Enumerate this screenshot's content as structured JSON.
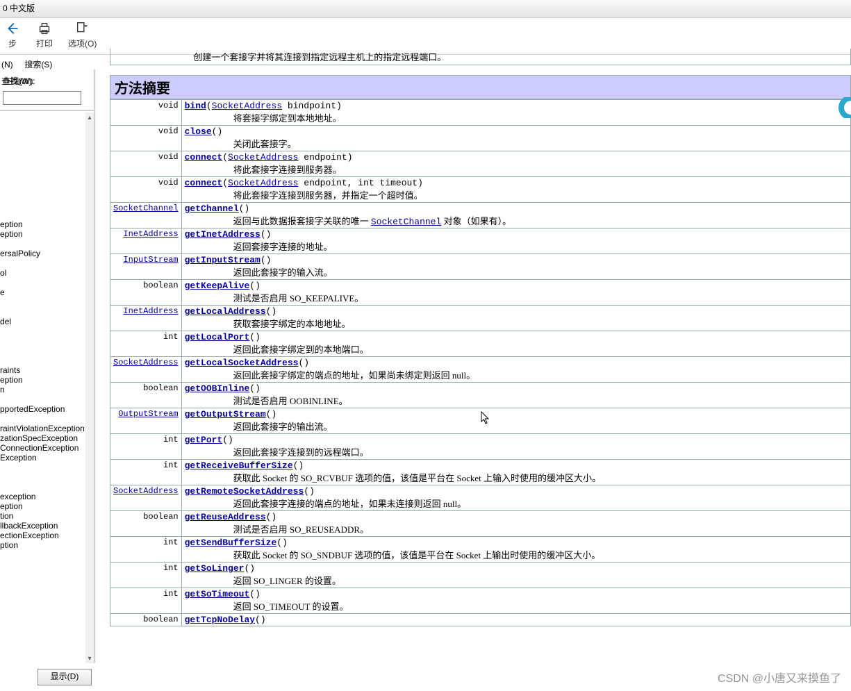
{
  "window": {
    "title": "0 中文版"
  },
  "toolbar": {
    "back": "步",
    "print": "打印",
    "options": "选项(O)"
  },
  "tabs": {
    "n": "(N)",
    "search": "搜索(S)"
  },
  "find": {
    "label": "查找(W):"
  },
  "sidebar": {
    "items": [
      "",
      "",
      "",
      "",
      "",
      "",
      "",
      "",
      "",
      "",
      "",
      "eption",
      "eption",
      "",
      "ersalPolicy",
      "",
      "ol",
      "",
      "e",
      "",
      "",
      "del",
      "",
      "",
      "",
      "",
      "raints",
      "eption",
      "n",
      "",
      "pportedException",
      "",
      "raintViolationException",
      "zationSpecException",
      "ConnectionException",
      "Exception",
      "",
      "",
      "",
      "exception",
      "eption",
      "tion",
      "llbackException",
      "ectionException",
      "ption"
    ]
  },
  "display_btn": "显示(D)",
  "constructor_note": "创建一个套接字并将其连接到指定远程主机上的指定远程端口。",
  "section_title": "方法摘要",
  "methods": [
    {
      "rt": "void",
      "name": "bind",
      "params": [
        {
          "type": "SocketAddress",
          "name": "bindpoint"
        }
      ],
      "desc": "将套接字绑定到本地地址。"
    },
    {
      "rt": "void",
      "name": "close",
      "params": [],
      "desc": "关闭此套接字。"
    },
    {
      "rt": "void",
      "name": "connect",
      "params": [
        {
          "type": "SocketAddress",
          "name": "endpoint"
        }
      ],
      "desc": "将此套接字连接到服务器。"
    },
    {
      "rt": "void",
      "name": "connect",
      "params": [
        {
          "type": "SocketAddress",
          "name": "endpoint"
        },
        {
          "type": "int",
          "name": "timeout"
        }
      ],
      "desc": "将此套接字连接到服务器，并指定一个超时值。"
    },
    {
      "rt_link": "SocketChannel",
      "name": "getChannel",
      "params": [],
      "desc": "返回与此数据报套接字关联的唯一 ",
      "desc_link": "SocketChannel",
      "desc_tail": " 对象（如果有）。"
    },
    {
      "rt_link": "InetAddress",
      "name": "getInetAddress",
      "params": [],
      "desc": "返回套接字连接的地址。"
    },
    {
      "rt_link": "InputStream",
      "name": "getInputStream",
      "params": [],
      "desc": "返回此套接字的输入流。"
    },
    {
      "rt": "boolean",
      "name": "getKeepAlive",
      "params": [],
      "desc": "测试是否启用 SO_KEEPALIVE。"
    },
    {
      "rt_link": "InetAddress",
      "name": "getLocalAddress",
      "params": [],
      "desc": "获取套接字绑定的本地地址。"
    },
    {
      "rt": "int",
      "name": "getLocalPort",
      "params": [],
      "desc": "返回此套接字绑定到的本地端口。"
    },
    {
      "rt_link": "SocketAddress",
      "name": "getLocalSocketAddress",
      "params": [],
      "desc": "返回此套接字绑定的端点的地址，如果尚未绑定则返回 null。"
    },
    {
      "rt": "boolean",
      "name": "getOOBInline",
      "params": [],
      "desc": "测试是否启用 OOBINLINE。"
    },
    {
      "rt_link": "OutputStream",
      "name": "getOutputStream",
      "params": [],
      "desc": "返回此套接字的输出流。"
    },
    {
      "rt": "int",
      "name": "getPort",
      "params": [],
      "desc": "返回此套接字连接到的远程端口。"
    },
    {
      "rt": "int",
      "name": "getReceiveBufferSize",
      "params": [],
      "desc": "获取此 Socket 的 SO_RCVBUF 选项的值，该值是平台在 Socket 上输入时使用的缓冲区大小。"
    },
    {
      "rt_link": "SocketAddress",
      "name": "getRemoteSocketAddress",
      "params": [],
      "desc": "返回此套接字连接的端点的地址，如果未连接则返回 null。"
    },
    {
      "rt": "boolean",
      "name": "getReuseAddress",
      "params": [],
      "desc": "测试是否启用 SO_REUSEADDR。"
    },
    {
      "rt": "int",
      "name": "getSendBufferSize",
      "params": [],
      "desc": "获取此 Socket 的 SO_SNDBUF 选项的值，该值是平台在 Socket 上输出时使用的缓冲区大小。"
    },
    {
      "rt": "int",
      "name": "getSoLinger",
      "params": [],
      "desc": "返回 SO_LINGER 的设置。"
    },
    {
      "rt": "int",
      "name": "getSoTimeout",
      "params": [],
      "desc": "返回 SO_TIMEOUT 的设置。"
    },
    {
      "rt": "boolean",
      "name": "getTcpNoDelay",
      "params": [],
      "desc": ""
    }
  ],
  "watermark": "CSDN @小唐又来摸鱼了"
}
